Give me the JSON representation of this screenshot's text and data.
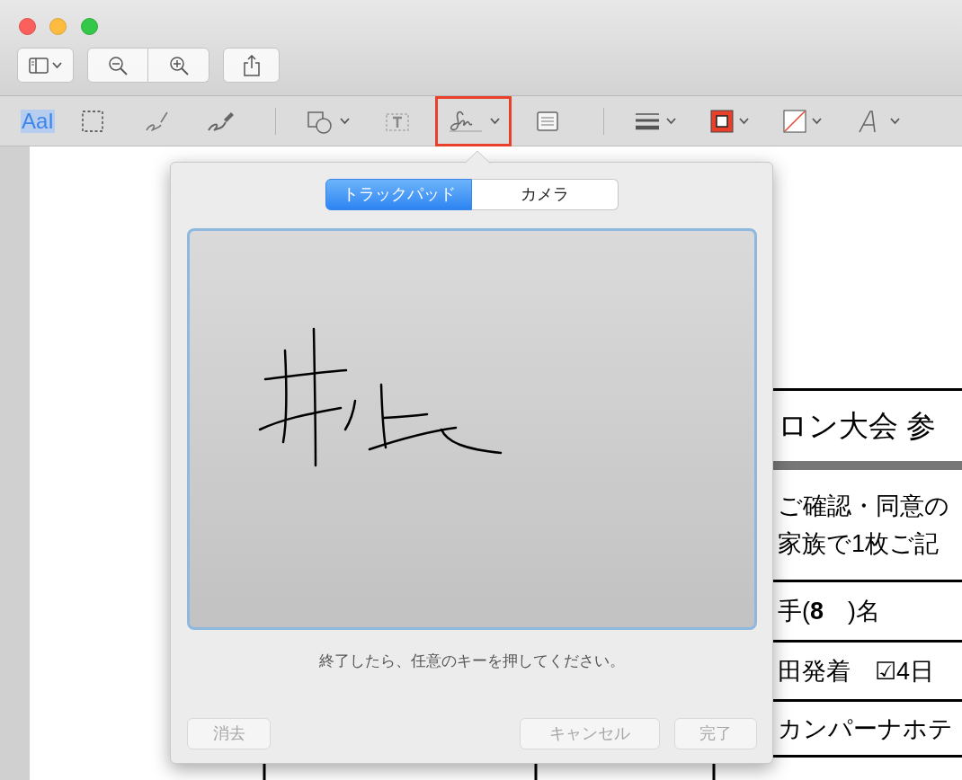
{
  "markup_toolbar": {
    "tools": [
      {
        "kind": "text",
        "label": "AaI",
        "selected": true,
        "outlined": false
      },
      {
        "kind": "select",
        "selected": false,
        "outlined": false
      },
      {
        "kind": "sketch",
        "selected": false,
        "outlined": false
      },
      {
        "kind": "draw",
        "selected": false,
        "outlined": false
      },
      {
        "kind": "separator"
      },
      {
        "kind": "shapes",
        "selected": false,
        "outlined": false
      },
      {
        "kind": "textbox",
        "selected": false,
        "outlined": false
      },
      {
        "kind": "signature",
        "selected": false,
        "outlined": true
      },
      {
        "kind": "note",
        "selected": false,
        "outlined": false
      },
      {
        "kind": "separator"
      },
      {
        "kind": "line_style",
        "selected": false,
        "outlined": false
      },
      {
        "kind": "border_color",
        "selected": false,
        "outlined": false
      },
      {
        "kind": "fill_color",
        "selected": false,
        "outlined": false
      },
      {
        "kind": "font",
        "selected": false,
        "outlined": false
      }
    ]
  },
  "signature_popover": {
    "tabs": [
      {
        "label": "トラックパッド",
        "selected": true
      },
      {
        "label": "カメラ",
        "selected": false
      }
    ],
    "instruction": "終了したら、任意のキーを押してください。",
    "buttons": [
      {
        "label": "消去",
        "disabled": true
      },
      {
        "label": "キャンセル",
        "disabled": true
      },
      {
        "label": "完了",
        "disabled": true
      }
    ]
  },
  "document": {
    "rows": [
      {
        "lines": [
          "ロン大会 参"
        ]
      },
      {
        "lines": [
          "ご確認・同意の",
          "家族で1枚ご記"
        ]
      },
      {
        "lines": [
          "手(**8**　)名"
        ]
      },
      {
        "lines": [
          "田発着　☑4日"
        ]
      },
      {
        "lines": [
          "カンパーナホテ"
        ]
      }
    ]
  }
}
